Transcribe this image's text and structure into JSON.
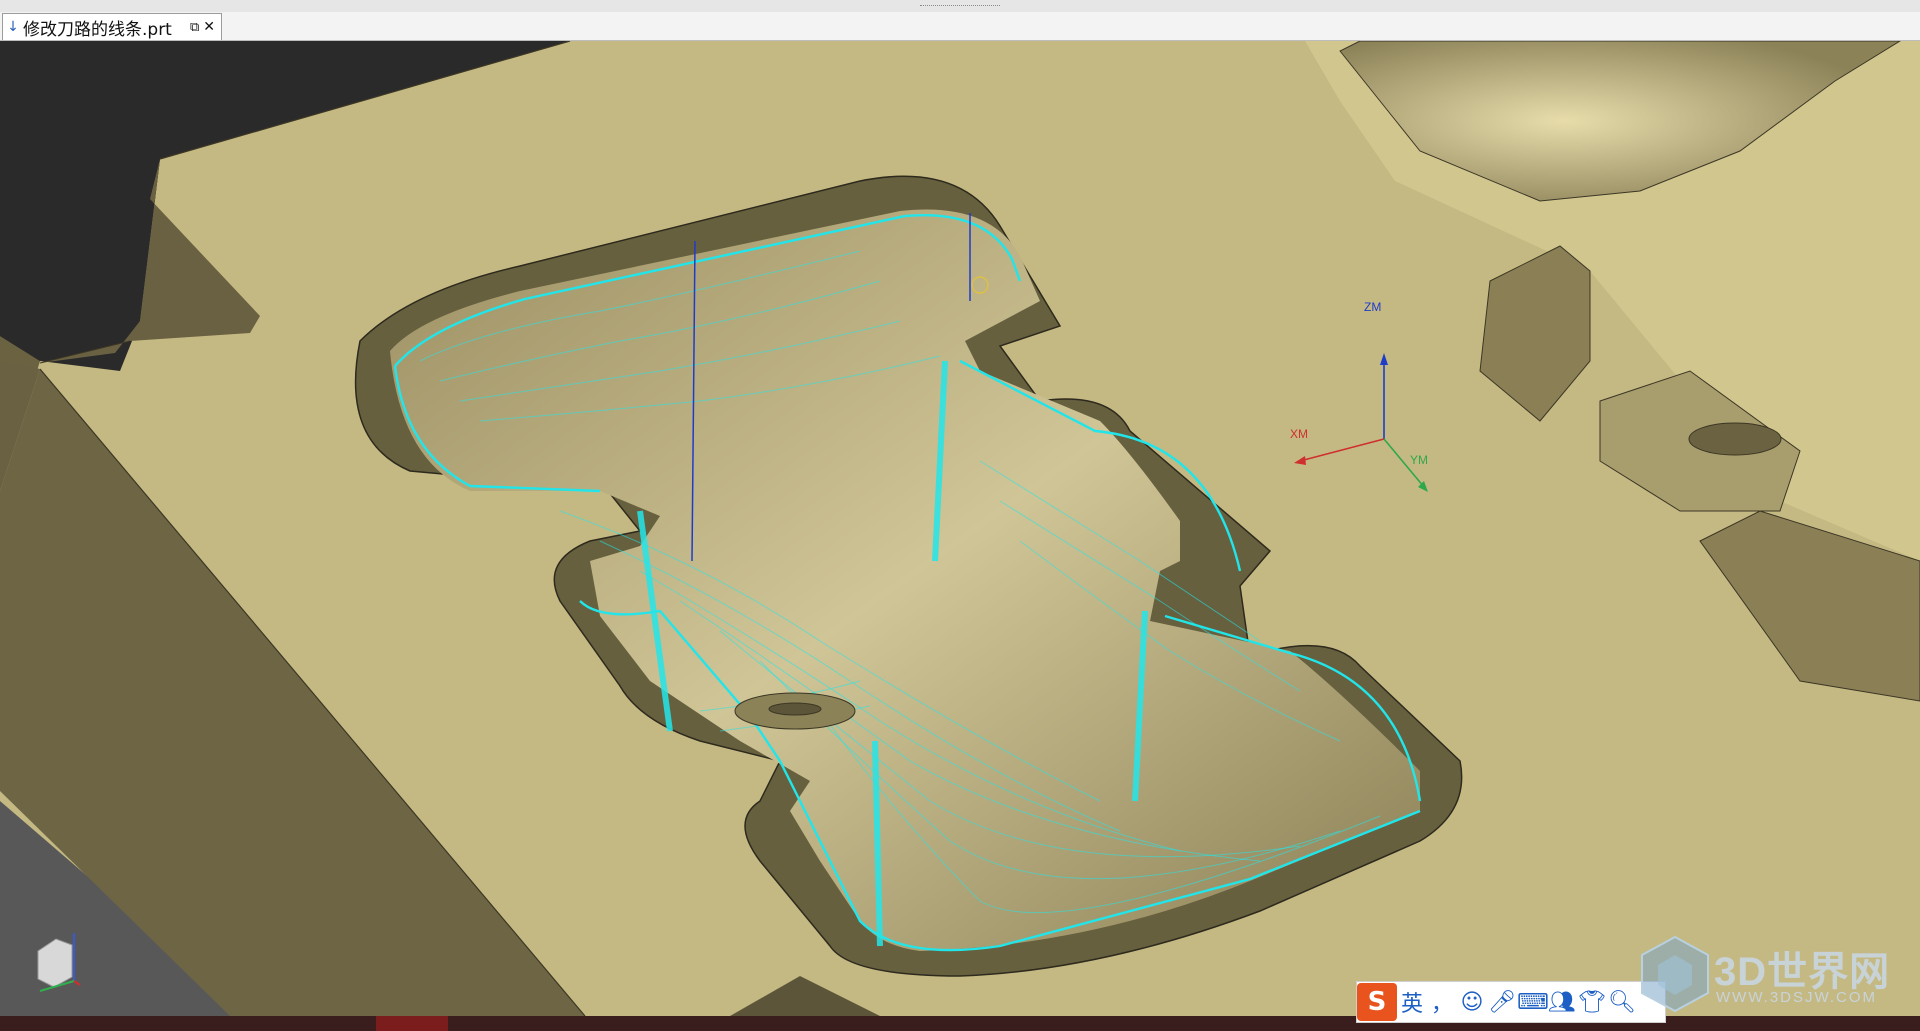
{
  "tab": {
    "title": "修改刀路的线条.prt"
  },
  "triad": {
    "z": "ZM",
    "x": "XM",
    "y": "YM"
  },
  "ime": {
    "mode": "英",
    "punct": "，"
  },
  "watermark": {
    "brand": "3D世界网",
    "url": "WWW.3DSJW.COM"
  },
  "colors": {
    "part": "#c5b983",
    "toolpath": "#22e5ea",
    "background": "#2a2a2a"
  }
}
